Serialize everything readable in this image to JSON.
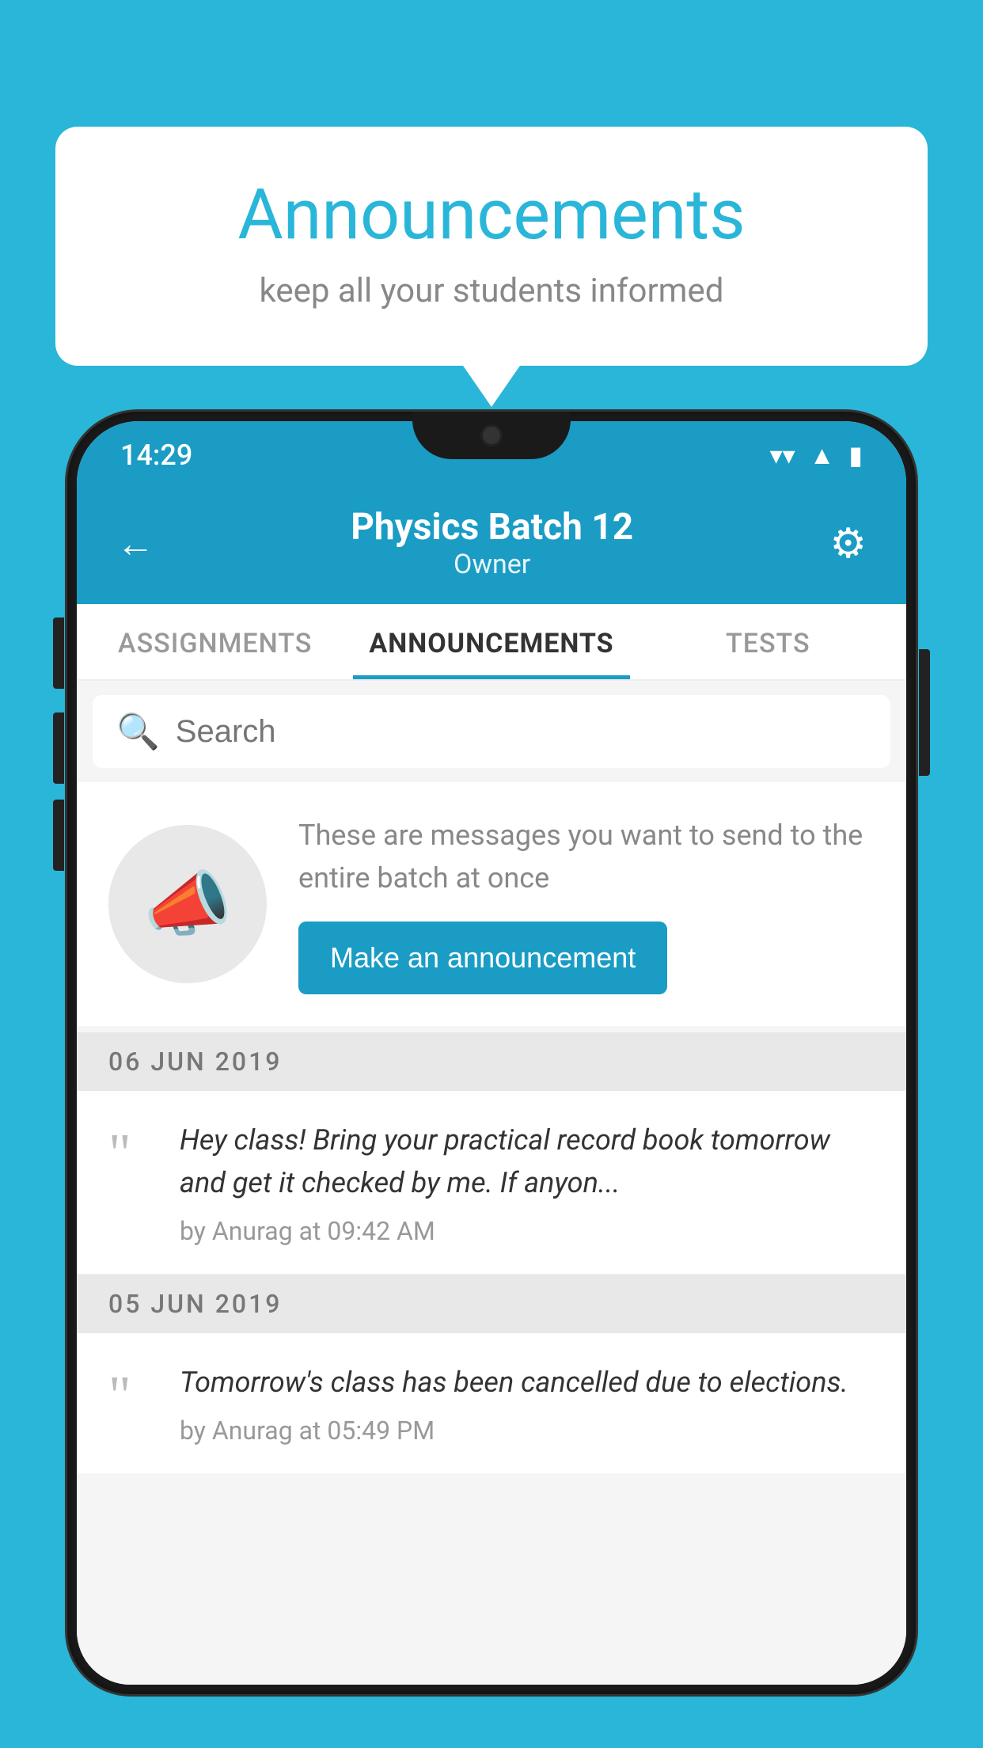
{
  "background_color": "#29b6d8",
  "speech_bubble": {
    "title": "Announcements",
    "subtitle": "keep all your students informed"
  },
  "phone": {
    "status_bar": {
      "time": "14:29",
      "wifi": "▲",
      "signal": "▲",
      "battery": "▮"
    },
    "header": {
      "title": "Physics Batch 12",
      "subtitle": "Owner",
      "back_label": "←",
      "settings_label": "⚙"
    },
    "tabs": [
      {
        "label": "ASSIGNMENTS",
        "active": false
      },
      {
        "label": "ANNOUNCEMENTS",
        "active": true
      },
      {
        "label": "TESTS",
        "active": false
      }
    ],
    "search": {
      "placeholder": "Search"
    },
    "promo": {
      "description": "These are messages you want to send to the entire batch at once",
      "button_label": "Make an announcement"
    },
    "announcements": [
      {
        "date": "06  JUN  2019",
        "message": "Hey class! Bring your practical record book tomorrow and get it checked by me. If anyon...",
        "author": "by Anurag at 09:42 AM"
      },
      {
        "date": "05  JUN  2019",
        "message": "Tomorrow's class has been cancelled due to elections.",
        "author": "by Anurag at 05:49 PM"
      }
    ]
  }
}
